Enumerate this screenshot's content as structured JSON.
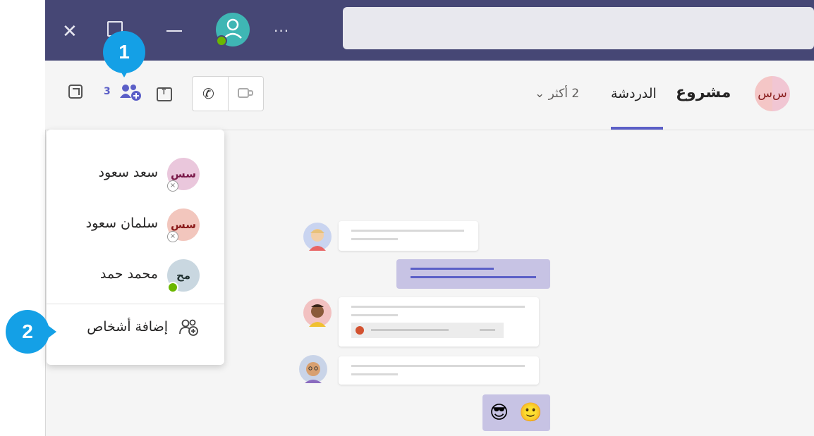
{
  "header": {
    "avatar_initials": "س‌س",
    "chat_title": "مشروع",
    "tab_chat": "الدردشة",
    "tab_more": "2 أكثر ⌄",
    "participants_count": "3"
  },
  "callouts": {
    "one": "1",
    "two": "2"
  },
  "participants": [
    {
      "initials": "سس",
      "name": "سعد سعود",
      "status": "offline"
    },
    {
      "initials": "سس",
      "name": "سلمان سعود",
      "status": "offline"
    },
    {
      "initials": "مح",
      "name": "محمد حمد",
      "status": "available"
    }
  ],
  "add_people_label": "إضافة أشخاص",
  "emojis": {
    "cool": "😎",
    "smile": "🙂"
  },
  "colors": {
    "titlebar": "#464775",
    "accent": "#5b5fc7",
    "callout": "#14a0e6",
    "presence": "#6bb700"
  }
}
